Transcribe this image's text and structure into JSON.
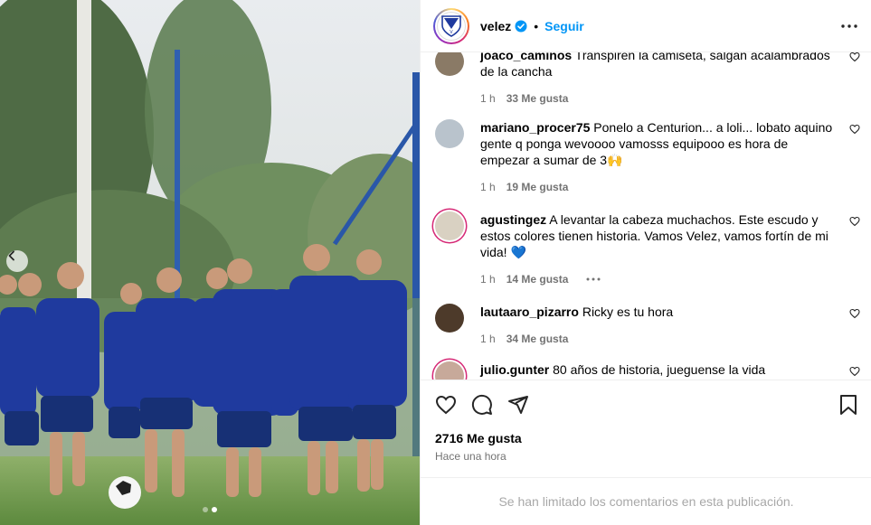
{
  "post": {
    "image_alt": "Jugadores de Vélez entrenando",
    "carousel": {
      "dots": 2,
      "active_index": 1
    }
  },
  "header": {
    "username": "velez",
    "separator": "•",
    "follow_label": "Seguir"
  },
  "comments": [
    {
      "user": "joaco_caminos",
      "text": "Transpiren la camiseta, salgan acalambrados de la cancha",
      "time": "1 h",
      "likes": "33 Me gusta",
      "avatar_color": "#8a7a66"
    },
    {
      "user": "mariano_procer75",
      "text": "Ponelo a Centurion... a loli... lobato aquino gente q ponga wevoooo vamosss equipooo es hora de empezar a sumar de 3🙌",
      "time": "1 h",
      "likes": "19 Me gusta",
      "avatar_color": "#b9c3cc"
    },
    {
      "user": "agustingez",
      "text": "A levantar la cabeza muchachos. Este escudo y estos colores tienen historia. Vamos Velez, vamos fortín de mi vida! 💙",
      "time": "1 h",
      "likes": "14 Me gusta",
      "avatar_color": "#d9d1c2"
    },
    {
      "user": "lautaaro_pizarro",
      "text": "Ricky es tu hora",
      "time": "1 h",
      "likes": "34 Me gusta",
      "avatar_color": "#4d3a2a"
    },
    {
      "user": "julio.gunter",
      "text": "80 años de historia, jueguense la vida",
      "time": "",
      "likes": "",
      "avatar_color": "#c7a99a"
    }
  ],
  "likes_total": "2716 Me gusta",
  "time_ago": "Hace una hora",
  "comments_limited": "Se han limitado los comentarios en esta publicación.",
  "colors": {
    "accent": "#0095f6",
    "muted": "#737373",
    "jersey": "#1f3a9e"
  }
}
